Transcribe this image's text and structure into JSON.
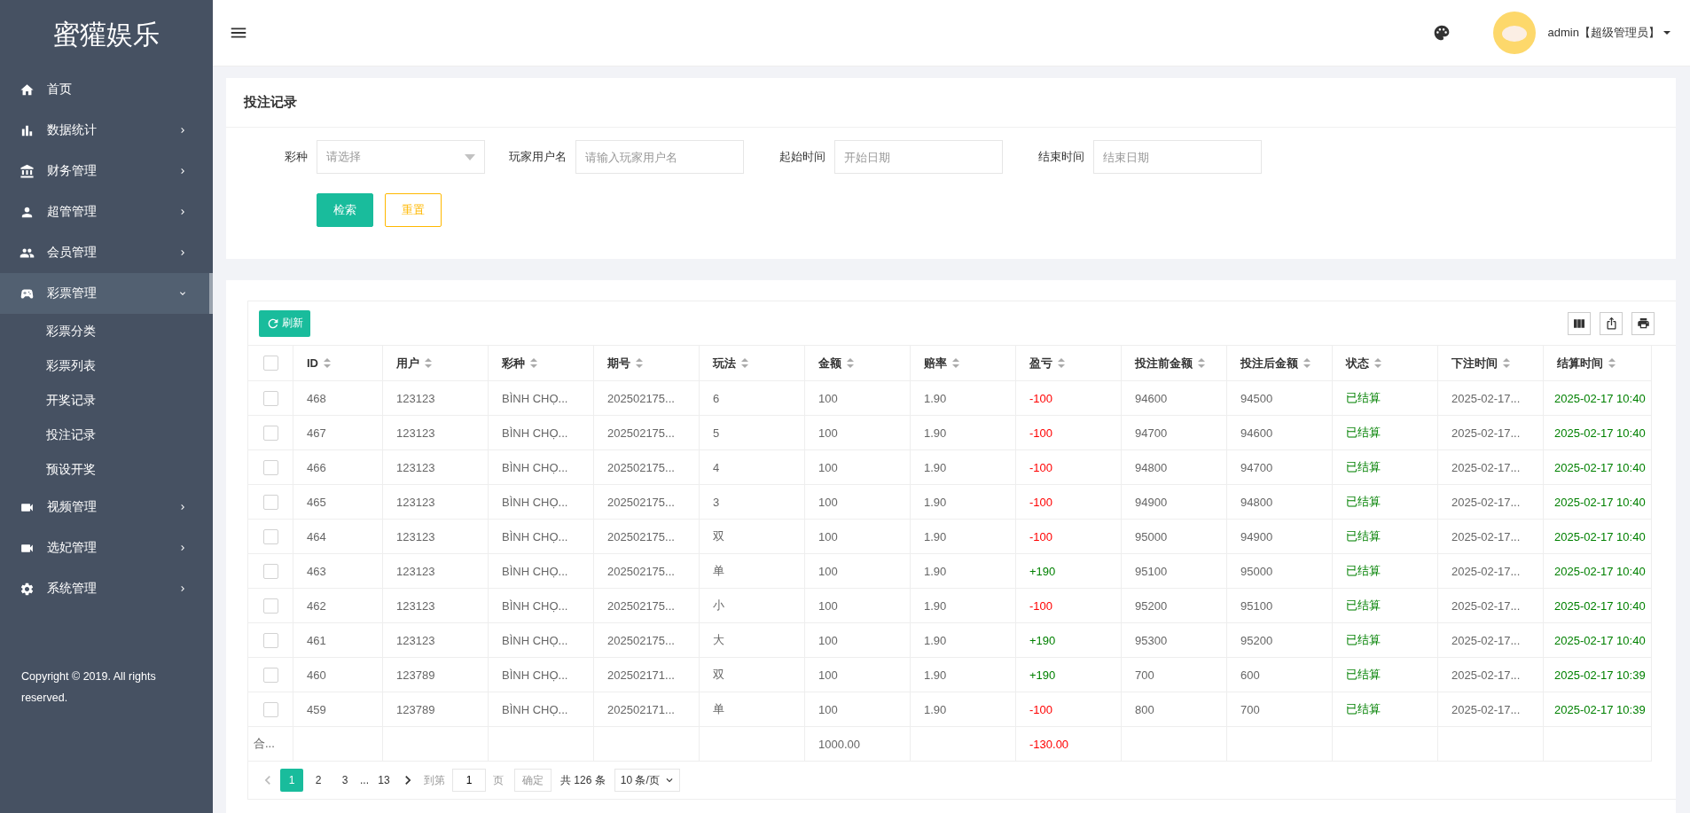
{
  "sidebar": {
    "logo": "蜜獾娱乐",
    "items": [
      {
        "label": "首页",
        "kind": "home",
        "selected": false
      },
      {
        "label": "数据统计",
        "kind": "chart",
        "selected": false,
        "expanded": false
      },
      {
        "label": "财务管理",
        "kind": "bank",
        "selected": false,
        "expanded": false
      },
      {
        "label": "超管管理",
        "kind": "person",
        "selected": false,
        "expanded": false
      },
      {
        "label": "会员管理",
        "kind": "people",
        "selected": false,
        "expanded": false
      },
      {
        "label": "彩票管理",
        "kind": "gamepad",
        "selected": true,
        "expanded": true,
        "children": [
          {
            "label": "彩票分类",
            "selected": false
          },
          {
            "label": "彩票列表",
            "selected": false
          },
          {
            "label": "开奖记录",
            "selected": false
          },
          {
            "label": "投注记录",
            "selected": false
          },
          {
            "label": "预设开奖",
            "selected": false
          }
        ]
      },
      {
        "label": "视频管理",
        "kind": "video",
        "selected": false,
        "expanded": false
      },
      {
        "label": "选妃管理",
        "kind": "video",
        "selected": false,
        "expanded": false
      },
      {
        "label": "系统管理",
        "kind": "gear",
        "selected": false,
        "expanded": false
      }
    ],
    "copyright": "Copyright © 2019. All rights reserved."
  },
  "header": {
    "user": "admin【超级管理员】"
  },
  "filter": {
    "title": "投注记录",
    "fields": [
      {
        "label": "彩种",
        "kind": "select",
        "placeholder": "请选择"
      },
      {
        "label": "玩家用户名",
        "kind": "input",
        "placeholder": "请输入玩家用户名"
      },
      {
        "label": "起始时间",
        "kind": "input",
        "placeholder": "开始日期"
      },
      {
        "label": "结束时间",
        "kind": "input",
        "placeholder": "结束日期"
      }
    ],
    "buttons": [
      {
        "label": "检索",
        "kind": "primary"
      },
      {
        "label": "重置",
        "kind": "outline"
      }
    ]
  },
  "table": {
    "refresh": "刷新",
    "all_checked": false,
    "columns": [
      "ID",
      "用户",
      "彩种",
      "期号",
      "玩法",
      "金额",
      "赔率",
      "盈亏",
      "投注前金额",
      "投注后金额",
      "状态",
      "下注时间",
      "结算时间"
    ],
    "rows": [
      {
        "checked": false,
        "kind": "loss",
        "cells": [
          "468",
          "123123",
          "BÌNH CHỌ...",
          "202502175...",
          "6",
          "100",
          "1.90",
          "-100",
          "94600",
          "94500",
          "已结算",
          "2025-02-17...",
          "2025-02-17 10:40"
        ]
      },
      {
        "checked": false,
        "kind": "loss",
        "cells": [
          "467",
          "123123",
          "BÌNH CHỌ...",
          "202502175...",
          "5",
          "100",
          "1.90",
          "-100",
          "94700",
          "94600",
          "已结算",
          "2025-02-17...",
          "2025-02-17 10:40"
        ]
      },
      {
        "checked": false,
        "kind": "loss",
        "cells": [
          "466",
          "123123",
          "BÌNH CHỌ...",
          "202502175...",
          "4",
          "100",
          "1.90",
          "-100",
          "94800",
          "94700",
          "已结算",
          "2025-02-17...",
          "2025-02-17 10:40"
        ]
      },
      {
        "checked": false,
        "kind": "loss",
        "cells": [
          "465",
          "123123",
          "BÌNH CHỌ...",
          "202502175...",
          "3",
          "100",
          "1.90",
          "-100",
          "94900",
          "94800",
          "已结算",
          "2025-02-17...",
          "2025-02-17 10:40"
        ]
      },
      {
        "checked": false,
        "kind": "loss",
        "cells": [
          "464",
          "123123",
          "BÌNH CHỌ...",
          "202502175...",
          "双",
          "100",
          "1.90",
          "-100",
          "95000",
          "94900",
          "已结算",
          "2025-02-17...",
          "2025-02-17 10:40"
        ]
      },
      {
        "checked": false,
        "kind": "gain",
        "cells": [
          "463",
          "123123",
          "BÌNH CHỌ...",
          "202502175...",
          "单",
          "100",
          "1.90",
          "+190",
          "95100",
          "95000",
          "已结算",
          "2025-02-17...",
          "2025-02-17 10:40"
        ]
      },
      {
        "checked": false,
        "kind": "loss",
        "cells": [
          "462",
          "123123",
          "BÌNH CHỌ...",
          "202502175...",
          "小",
          "100",
          "1.90",
          "-100",
          "95200",
          "95100",
          "已结算",
          "2025-02-17...",
          "2025-02-17 10:40"
        ]
      },
      {
        "checked": false,
        "kind": "gain",
        "cells": [
          "461",
          "123123",
          "BÌNH CHỌ...",
          "202502175...",
          "大",
          "100",
          "1.90",
          "+190",
          "95300",
          "95200",
          "已结算",
          "2025-02-17...",
          "2025-02-17 10:40"
        ]
      },
      {
        "checked": false,
        "kind": "gain",
        "cells": [
          "460",
          "123789",
          "BÌNH CHỌ...",
          "202502171...",
          "双",
          "100",
          "1.90",
          "+190",
          "700",
          "600",
          "已结算",
          "2025-02-17...",
          "2025-02-17 10:39"
        ]
      },
      {
        "checked": false,
        "kind": "loss",
        "cells": [
          "459",
          "123789",
          "BÌNH CHỌ...",
          "202502171...",
          "单",
          "100",
          "1.90",
          "-100",
          "800",
          "700",
          "已结算",
          "2025-02-17...",
          "2025-02-17 10:39"
        ]
      }
    ],
    "totals": {
      "label": "合...",
      "amount": "1000.00",
      "profit": "-130.00"
    }
  },
  "pagination": {
    "pages": [
      {
        "label": "1",
        "selected": true
      },
      {
        "label": "2",
        "selected": false
      },
      {
        "label": "3",
        "selected": false
      },
      {
        "label": "...",
        "kind": "ellipsis"
      },
      {
        "label": "13",
        "selected": false
      }
    ],
    "goto_label": "到第",
    "goto_value": "1",
    "page_unit": "页",
    "confirm": "确定",
    "total": "共 126 条",
    "page_size": "10 条/页"
  }
}
